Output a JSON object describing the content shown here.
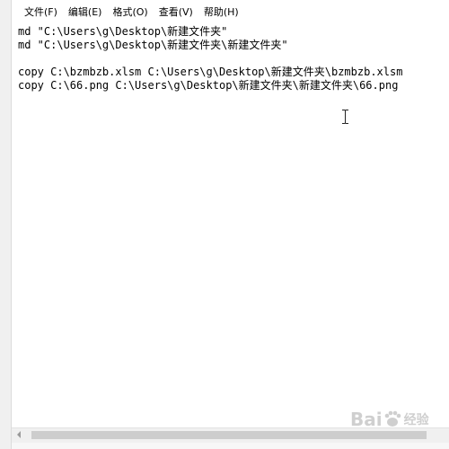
{
  "menu": {
    "items": [
      {
        "label": "文件(F)"
      },
      {
        "label": "编辑(E)"
      },
      {
        "label": "格式(O)"
      },
      {
        "label": "查看(V)"
      },
      {
        "label": "帮助(H)"
      }
    ]
  },
  "editor": {
    "lines": [
      "md \"C:\\Users\\g\\Desktop\\新建文件夹\"",
      "md \"C:\\Users\\g\\Desktop\\新建文件夹\\新建文件夹\"",
      "",
      "copy C:\\bzmbzb.xlsm C:\\Users\\g\\Desktop\\新建文件夹\\bzmbzb.xlsm",
      "copy C:\\66.png C:\\Users\\g\\Desktop\\新建文件夹\\新建文件夹\\66.png"
    ]
  },
  "watermark": {
    "brand": "Bai",
    "sub": "经验"
  },
  "colors": {
    "menubar_bg": "#ffffff",
    "editor_bg": "#ffffff",
    "text": "#000000",
    "scrollbar_bg": "#f0f0f0",
    "scrollbar_thumb": "#cdcdcd"
  },
  "icons": {
    "cursor": "ibeam-cursor-icon",
    "scroll_left": "scroll-left-arrow-icon"
  }
}
